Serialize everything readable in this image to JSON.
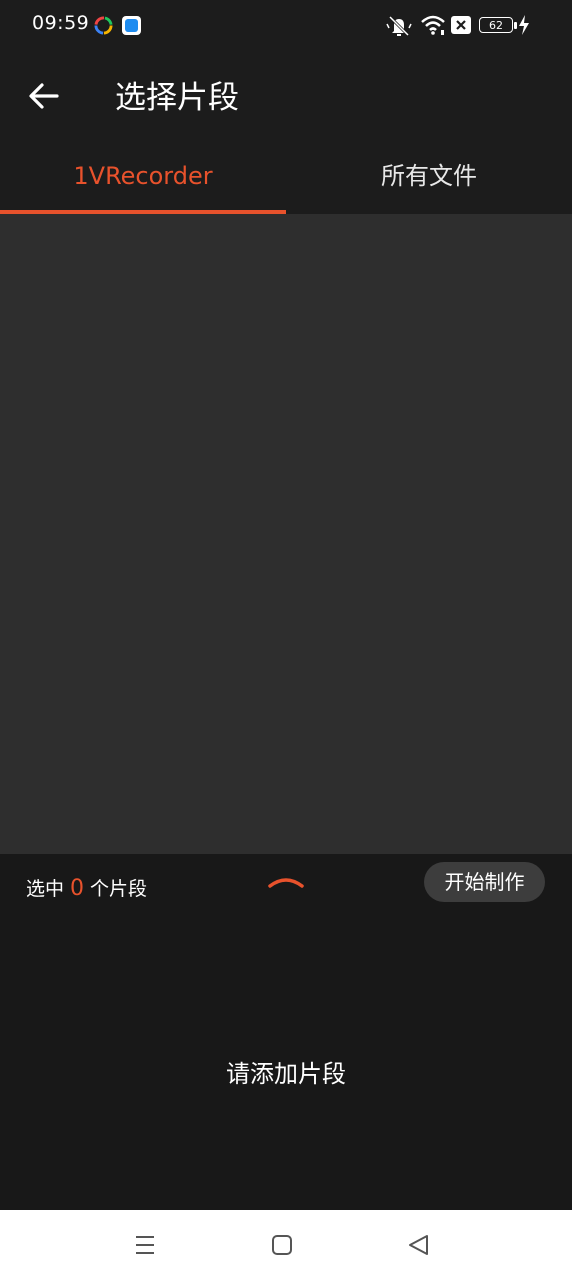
{
  "status_bar": {
    "time": "09:59",
    "battery_level": "62",
    "icons": [
      "app-icon-multicolor",
      "app-icon-blue",
      "bell-mute-icon",
      "wifi-icon",
      "notification-x-icon",
      "battery-icon",
      "charging-bolt-icon"
    ]
  },
  "header": {
    "title": "选择片段",
    "back_icon": "arrow-left-icon"
  },
  "tabs": [
    {
      "label": "1VRecorder",
      "active": true
    },
    {
      "label": "所有文件",
      "active": false
    }
  ],
  "bottom_panel": {
    "selected_prefix": "选中",
    "selected_count": "0",
    "selected_suffix": "个片段",
    "expand_icon": "chevron-up-icon",
    "start_button_label": "开始制作",
    "empty_hint": "请添加片段"
  },
  "nav_bar": {
    "icons": [
      "menu-icon",
      "home-square-icon",
      "back-triangle-icon"
    ]
  },
  "colors": {
    "accent": "#e8522c",
    "background": "#1c1c1c",
    "content_bg": "#2e2e2e",
    "panel_bg": "#181818"
  }
}
